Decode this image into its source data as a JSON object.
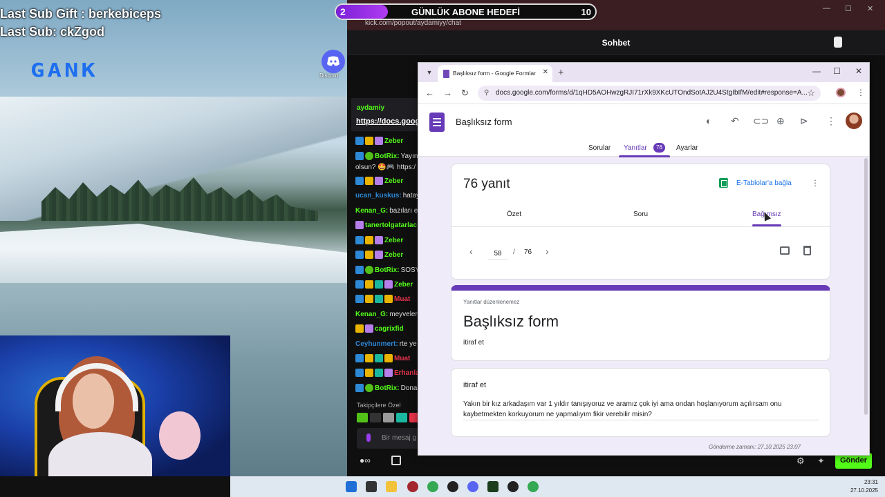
{
  "stream": {
    "last_sub_gift": "Last Sub Gift : berkebiceps",
    "last_sub": "Last Sub: ckZgod",
    "logo_text": "GANK",
    "discord_label": "Discord"
  },
  "goal": {
    "current": "2",
    "title": "GÜNLÜK ABONE HEDEFİ",
    "target": "10",
    "progress_fraction": 0.2
  },
  "kick": {
    "url": "kick.com/popout/aydamiyy/chat",
    "header_title": "Sohbet",
    "pinned_user": "aydamiy",
    "pinned_link": "https://docs.googl",
    "chat": [
      {
        "user": "Zeber",
        "text": "",
        "color": "#53fc18"
      },
      {
        "user": "BotRix:",
        "text": "Yayın",
        "color": "#53fc18"
      },
      {
        "user": "",
        "text": "olsun? 🤩🎮 https:/",
        "color": "#ddd"
      },
      {
        "user": "Zeber",
        "text": "",
        "color": "#53fc18"
      },
      {
        "user": "ucan_kuskus:",
        "text": "hatay",
        "color": "#2d88d6"
      },
      {
        "user": "Kenan_G:",
        "text": "bazıları ev",
        "color": "#53fc18"
      },
      {
        "user": "tanertolgatarlac",
        "text": "",
        "color": "#53fc18"
      },
      {
        "user": "Zeber",
        "text": "",
        "color": "#53fc18"
      },
      {
        "user": "Zeber",
        "text": "",
        "color": "#53fc18"
      },
      {
        "user": "BotRix:",
        "text": "SOSY",
        "color": "#53fc18"
      },
      {
        "user": "Zeber",
        "text": "",
        "color": "#53fc18"
      },
      {
        "user": "Muat",
        "text": "",
        "color": "#e8334a"
      },
      {
        "user": "Kenan_G:",
        "text": "meyveler",
        "color": "#53fc18"
      },
      {
        "user": "cagrixfid",
        "text": "",
        "color": "#53fc18"
      },
      {
        "user": "Ceyhunmert:",
        "text": "rte ye",
        "color": "#2d88d6"
      },
      {
        "user": "Muat",
        "text": "",
        "color": "#e8334a"
      },
      {
        "user": "Erhanlan",
        "text": "",
        "color": "#e8334a"
      },
      {
        "user": "BotRix:",
        "text": "Dona",
        "color": "#53fc18"
      }
    ],
    "followers_label": "Takipçilere Özel",
    "input_placeholder": "Bir mesaj g",
    "send_label": "Gönder"
  },
  "chrome": {
    "tab_title": "Başlıksız form - Google Formlar",
    "url": "docs.google.com/forms/d/1qHD5AOHwzgRJI71rXk9XKcUTOndSotAJ2U4StgIbIfM/edit#response=A..."
  },
  "forms": {
    "title": "Başlıksız form",
    "tabs": {
      "questions": "Sorular",
      "responses": "Yanıtlar",
      "responses_count": "76",
      "settings": "Ayarlar"
    },
    "summary": {
      "count_title": "76 yanıt",
      "sheets_link": "E-Tablolar'a bağla",
      "sub_tabs": {
        "summary": "Özet",
        "question": "Soru",
        "individual": "Bağımsız"
      },
      "pager_current": "58",
      "pager_sep": "/",
      "pager_total": "76"
    },
    "response": {
      "not_editable": "Yanıtlar düzenlenemez",
      "form_title": "Başlıksız form",
      "form_desc": "itiraf et",
      "question_title": "itiraf et",
      "answer": "Yakın bir kız arkadaşım var 1 yıldır tanışıyoruz ve aramız çok iyi ama ondan hoşlanıyorum açılırsam onu kaybetmekten korkuyorum ne yapmalıyım fikir verebilir misin?",
      "submitted": "Gönderme zamanı: 27.10.2025 23:07"
    }
  },
  "taskbar": {
    "time": "23:31",
    "date": "27.10.2025"
  }
}
